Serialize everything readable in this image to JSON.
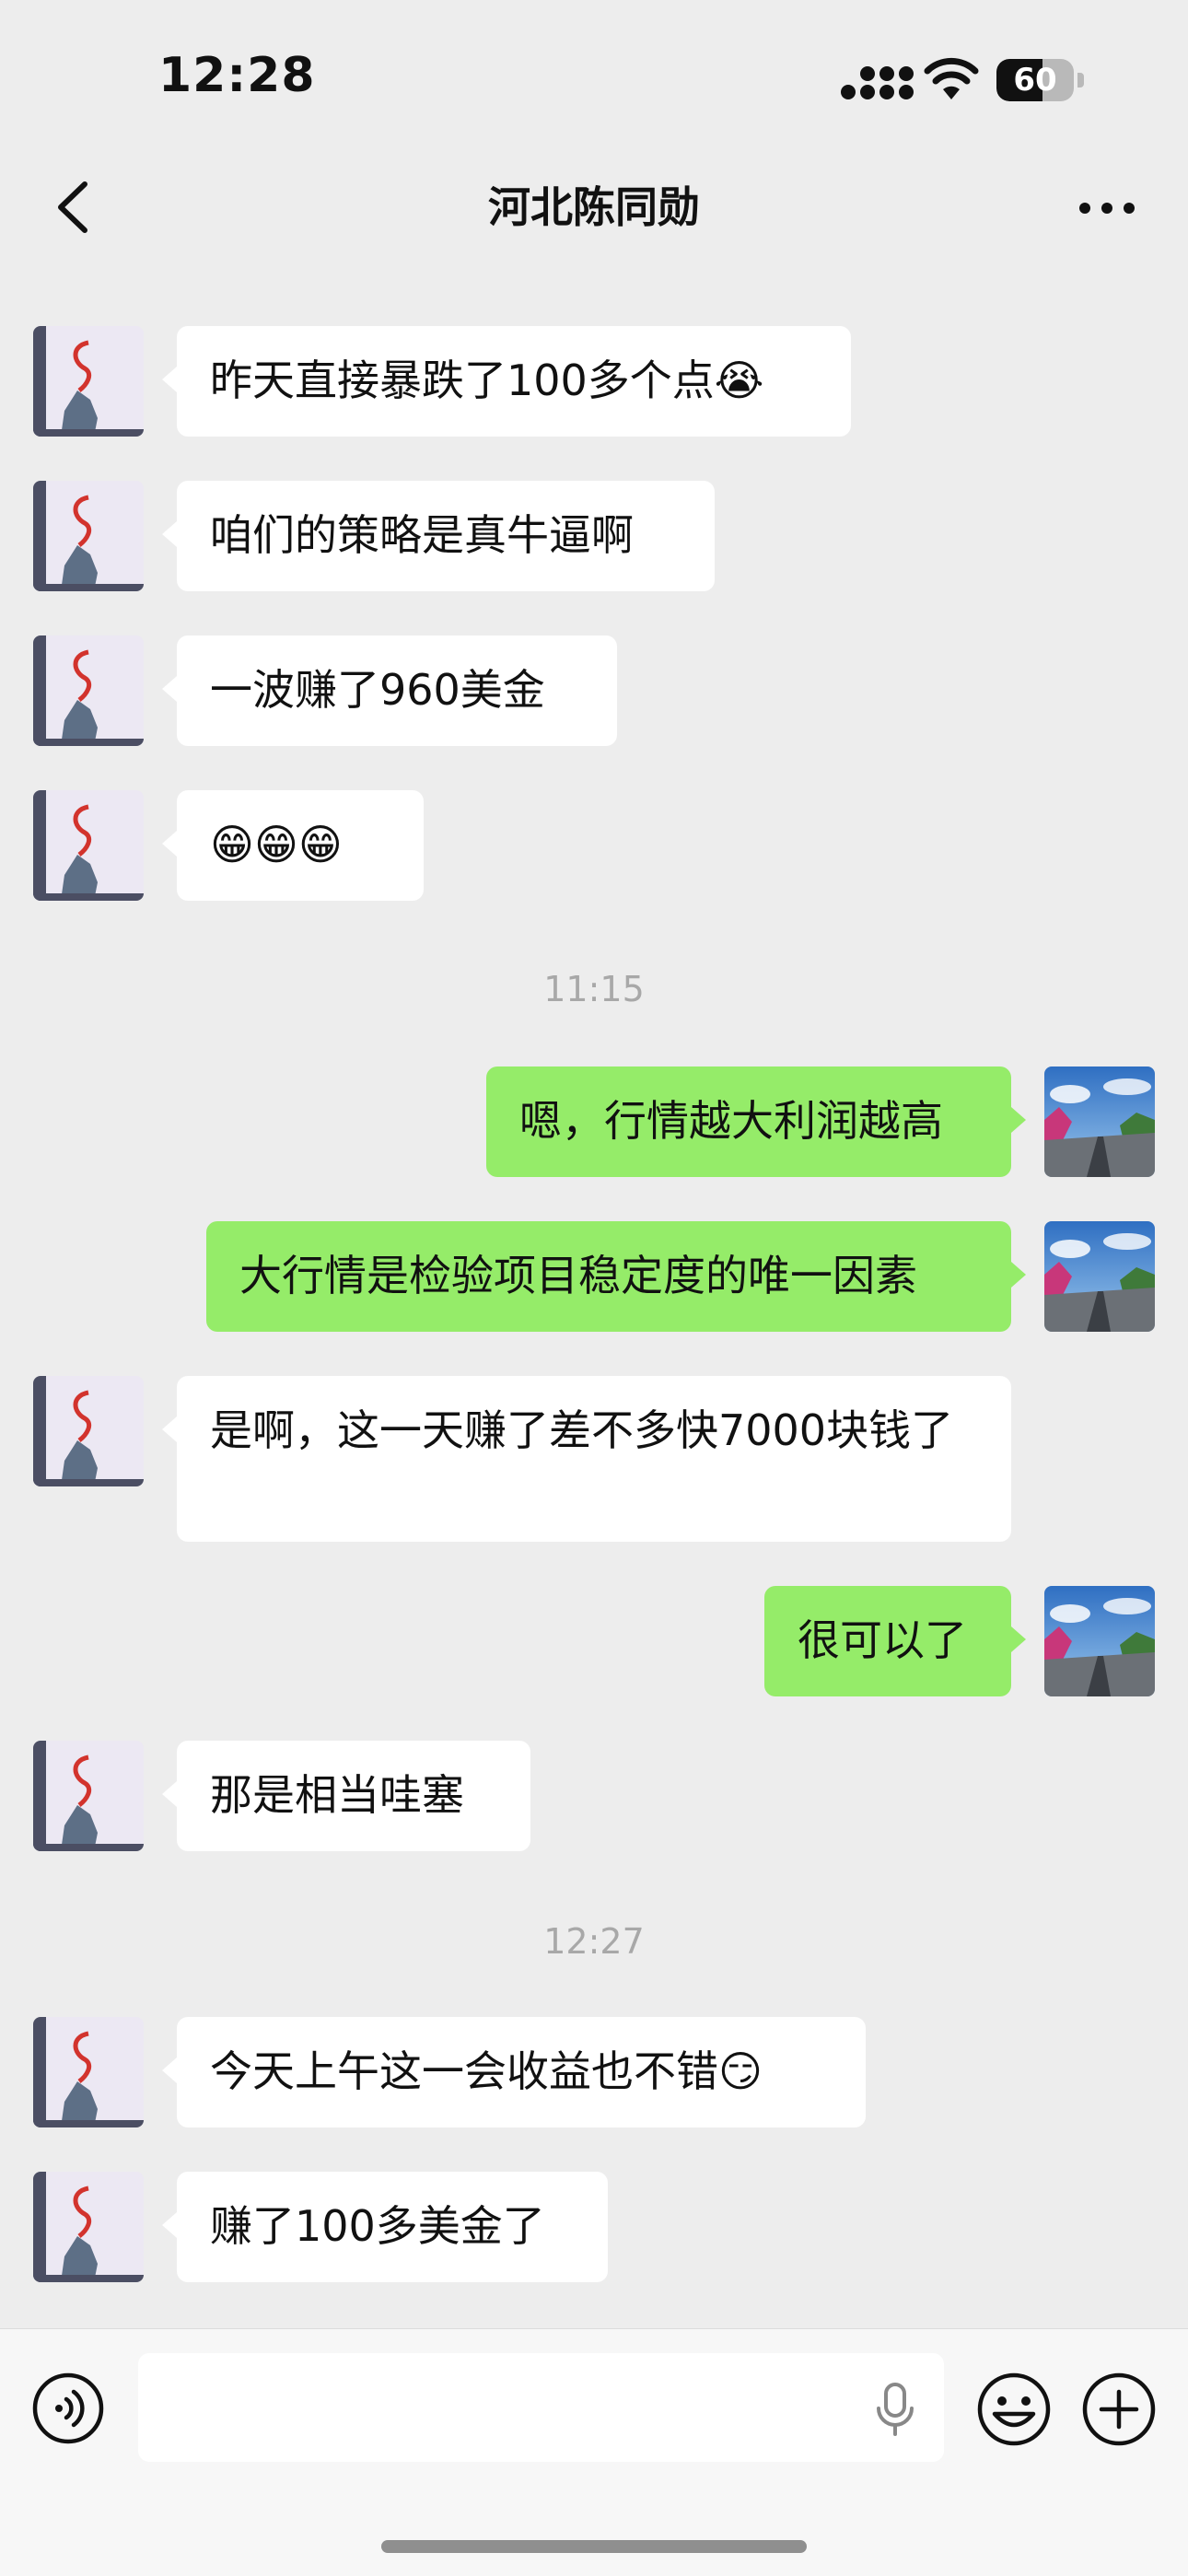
{
  "status_bar": {
    "time": "12:28",
    "battery": "60",
    "battery_level": 0.6
  },
  "header": {
    "title": "河北陈同勋",
    "back_icon": "chevron-left-icon",
    "more_icon": "more-dots-icon"
  },
  "timestamps": [
    "11:15",
    "12:27"
  ],
  "messages": [
    {
      "side": "in",
      "text": "昨天直接暴跌了100多个点😭"
    },
    {
      "side": "in",
      "text": "咱们的策略是真牛逼啊"
    },
    {
      "side": "in",
      "text": "一波赚了960美金"
    },
    {
      "side": "in",
      "text": "😁😁😁"
    },
    {
      "side": "out",
      "text": "嗯，行情越大利润越高"
    },
    {
      "side": "out",
      "text": "大行情是检验项目稳定度的唯一因素"
    },
    {
      "side": "in",
      "text": "是啊，这一天赚了差不多快7000块钱了"
    },
    {
      "side": "out",
      "text": "很可以了"
    },
    {
      "side": "in",
      "text": "那是相当哇塞"
    },
    {
      "side": "in",
      "text": "今天上午这一会收益也不错😏"
    },
    {
      "side": "in",
      "text": "赚了100多美金了"
    }
  ],
  "input_bar": {
    "placeholder": "",
    "voice_icon": "voice-icon",
    "mic_icon": "microphone-icon",
    "emoji_icon": "emoji-icon",
    "plus_icon": "plus-icon"
  },
  "colors": {
    "background": "#ededed",
    "outgoing": "#95ec69",
    "incoming": "#ffffff"
  }
}
